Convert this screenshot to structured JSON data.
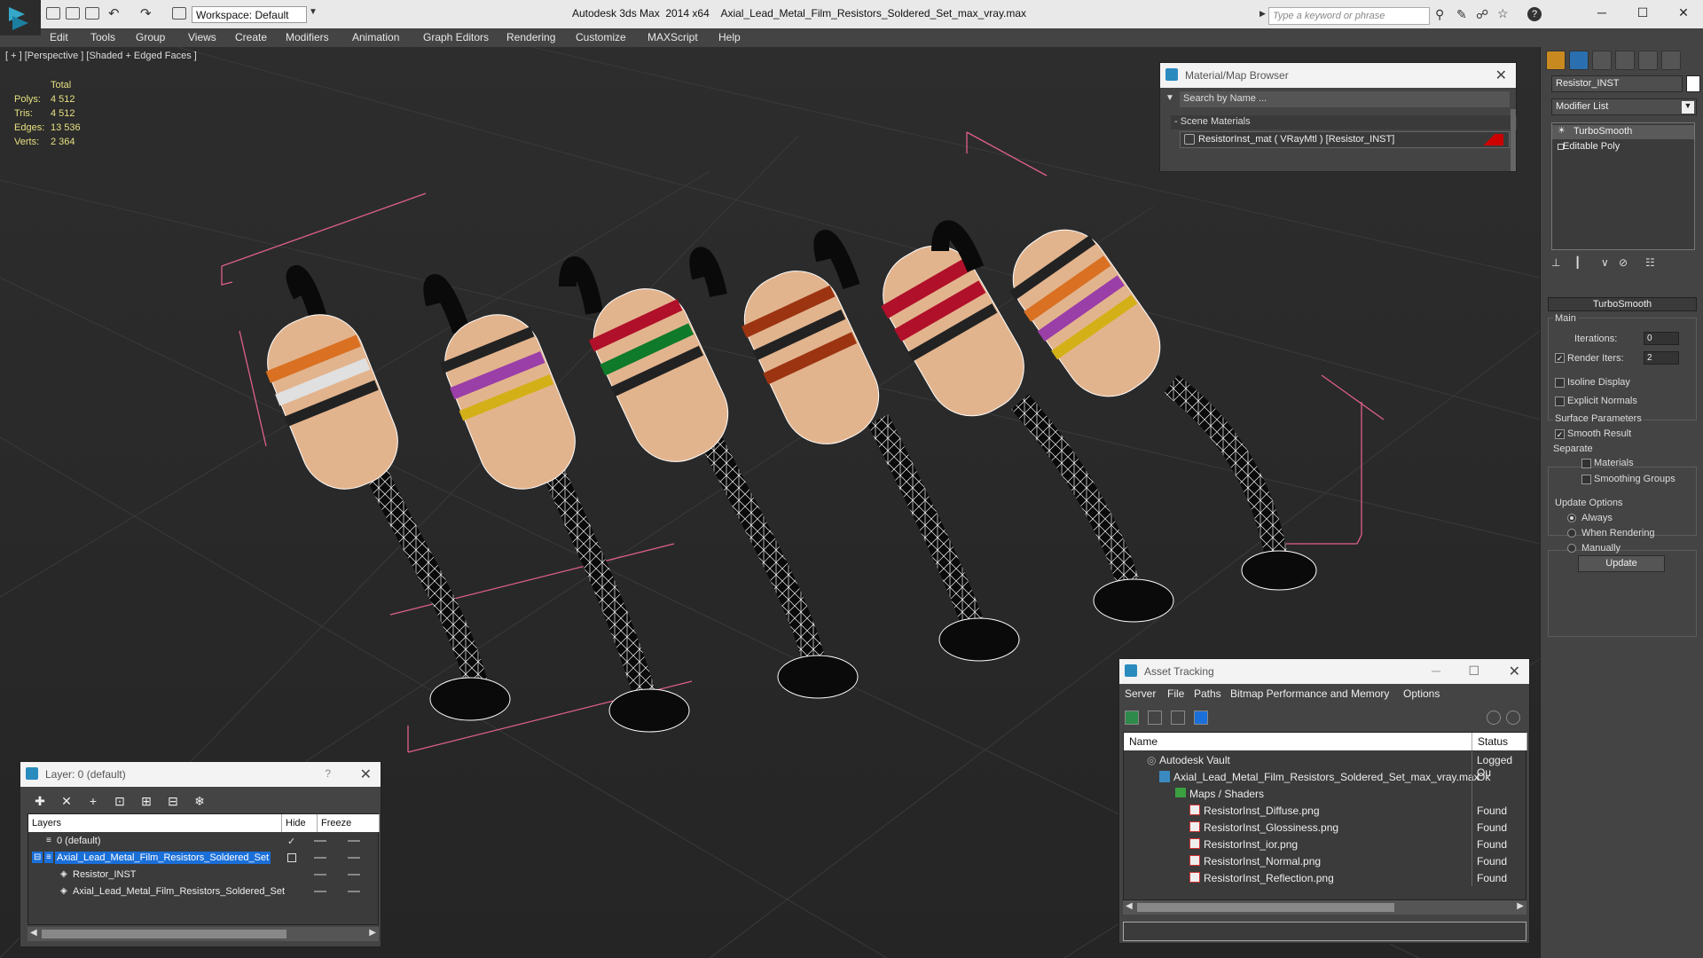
{
  "titlebar": {
    "workspace": "Workspace: Default",
    "app_name": "Autodesk 3ds Max  2014 x64",
    "file_name": "Axial_Lead_Metal_Film_Resistors_Soldered_Set_max_vray.max",
    "search_placeholder": "Type a keyword or phrase"
  },
  "menu": [
    "Edit",
    "Tools",
    "Group",
    "Views",
    "Create",
    "Modifiers",
    "Animation",
    "Graph Editors",
    "Rendering",
    "Customize",
    "MAXScript",
    "Help"
  ],
  "viewport": {
    "label": "[ + ] [Perspective ] [Shaded + Edged Faces ]",
    "stats": {
      "header": "Total",
      "rows": [
        {
          "label": "Polys:",
          "value": "4 512"
        },
        {
          "label": "Tris:",
          "value": "4 512"
        },
        {
          "label": "Edges:",
          "value": "13 536"
        },
        {
          "label": "Verts:",
          "value": "2 364"
        }
      ]
    }
  },
  "material_browser": {
    "title": "Material/Map Browser",
    "search": "Search by Name ...",
    "section": "- Scene Materials",
    "material": "ResistorInst_mat  ( VRayMtl ) [Resistor_INST]"
  },
  "asset_tracking": {
    "title": "Asset Tracking",
    "menu": [
      "Server",
      "File",
      "Paths",
      "Bitmap Performance and Memory",
      "Options"
    ],
    "columns": [
      "Name",
      "Status"
    ],
    "rows": [
      {
        "name": "Autodesk Vault",
        "status": "Logged Ou"
      },
      {
        "name": "Axial_Lead_Metal_Film_Resistors_Soldered_Set_max_vray.max",
        "status": "Ok"
      },
      {
        "name": "Maps / Shaders",
        "status": ""
      },
      {
        "name": "ResistorInst_Diffuse.png",
        "status": "Found"
      },
      {
        "name": "ResistorInst_Glossiness.png",
        "status": "Found"
      },
      {
        "name": "ResistorInst_ior.png",
        "status": "Found"
      },
      {
        "name": "ResistorInst_Normal.png",
        "status": "Found"
      },
      {
        "name": "ResistorInst_Reflection.png",
        "status": "Found"
      }
    ]
  },
  "layer_panel": {
    "title": "Layer: 0 (default)",
    "help": "?",
    "columns": [
      "Layers",
      "Hide",
      "Freeze"
    ],
    "rows": [
      {
        "name": "0 (default)"
      },
      {
        "name": "Axial_Lead_Metal_Film_Resistors_Soldered_Set"
      },
      {
        "name": "Resistor_INST"
      },
      {
        "name": "Axial_Lead_Metal_Film_Resistors_Soldered_Set"
      }
    ]
  },
  "command_panel": {
    "object_name": "Resistor_INST",
    "modifier_list": "Modifier List",
    "stack": [
      "TurboSmooth",
      "Editable Poly"
    ],
    "rollout": "TurboSmooth",
    "main_group": "Main",
    "iterations_label": "Iterations:",
    "iterations_value": "0",
    "render_iters_label": "Render Iters:",
    "render_iters_value": "2",
    "isoline": "Isoline Display",
    "explicit_normals": "Explicit Normals",
    "surface_group": "Surface Parameters",
    "smooth_result": "Smooth Result",
    "separate": "Separate",
    "materials": "Materials",
    "smoothing_groups": "Smoothing Groups",
    "update_group": "Update Options",
    "always": "Always",
    "when_rendering": "When Rendering",
    "manually": "Manually",
    "update_btn": "Update"
  },
  "colors": {
    "selection": "#1a6fd8",
    "stats_text": "#e6e080",
    "bbox": "#e0608a"
  }
}
